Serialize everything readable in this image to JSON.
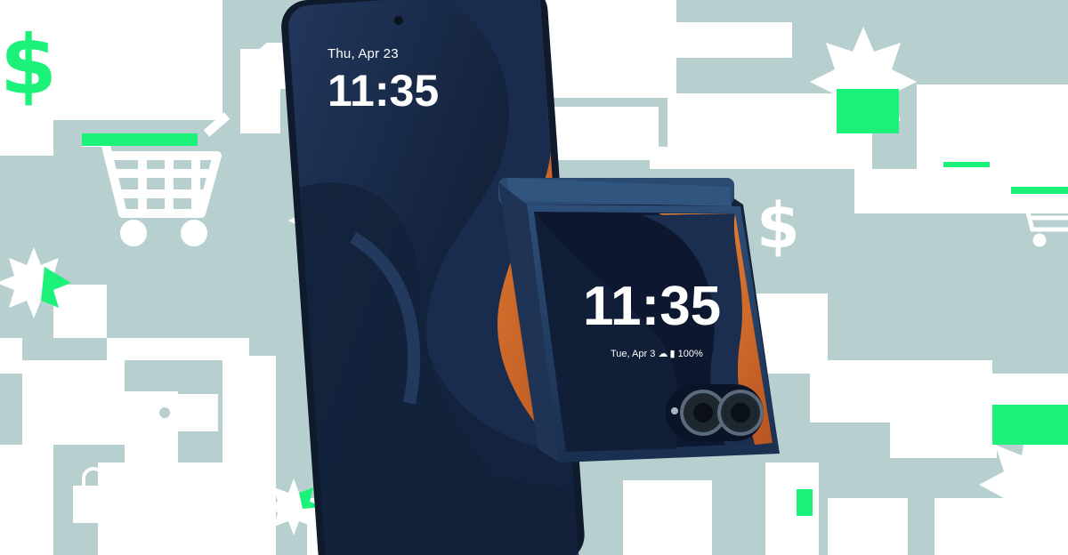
{
  "background": {
    "colors": {
      "teal": "#b7cfcf",
      "white": "#ffffff",
      "green": "#1cf27a",
      "phone_body": "#1a2a44",
      "wallpaper_blue": "#1c2f52",
      "wallpaper_orange": "#e07a34"
    },
    "icons": [
      "dollar-icon",
      "shopping-cart-icon",
      "price-tag-icon",
      "shopping-bag-icon",
      "starburst-icon"
    ]
  },
  "open_phone": {
    "date": "Thu, Apr 23",
    "time": "11:35"
  },
  "cover_screen": {
    "time": "11:35",
    "date": "Tue, Apr 3",
    "battery": "100%"
  }
}
